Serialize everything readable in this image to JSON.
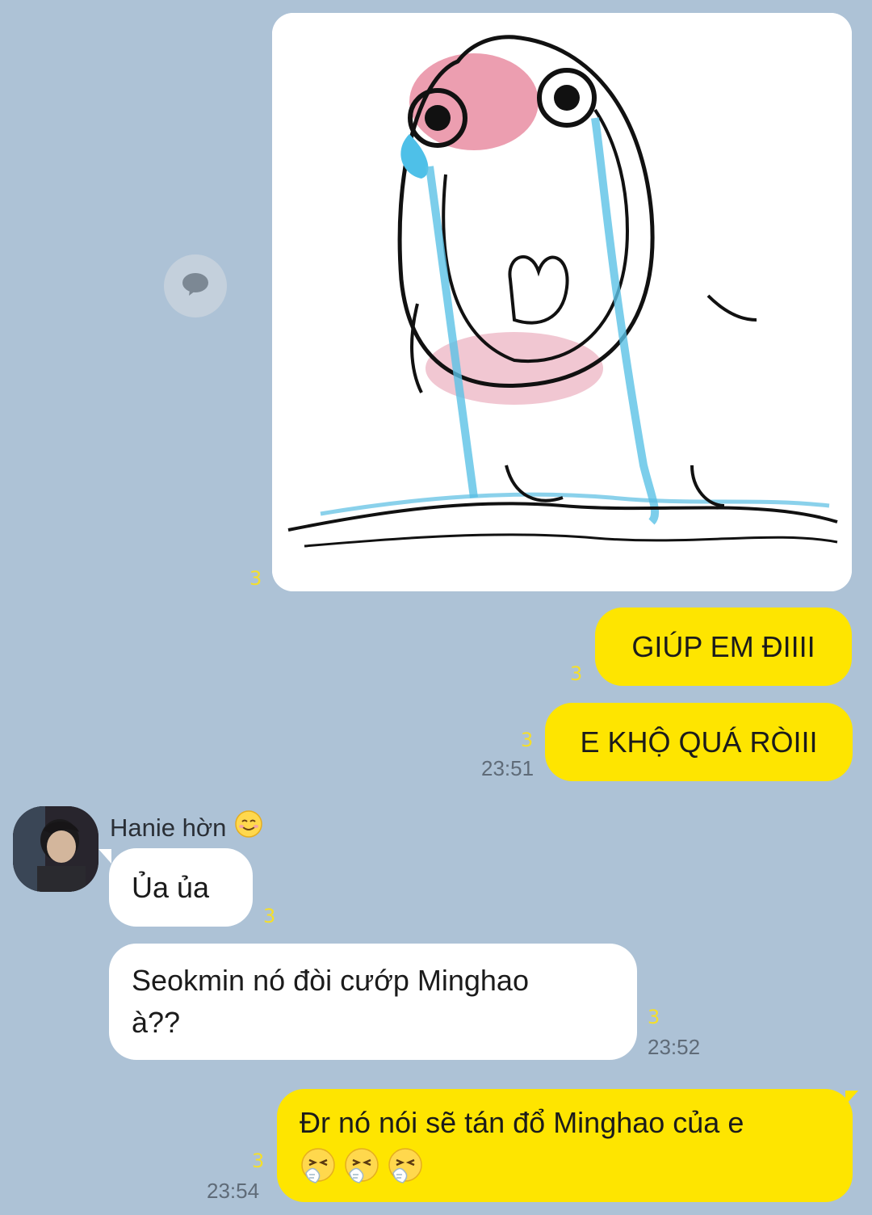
{
  "conversation": {
    "messages": [
      {
        "id": "img",
        "sender": "me",
        "kind": "image",
        "image_desc": "crying-doodle",
        "unread": "3"
      },
      {
        "id": "m1",
        "sender": "me",
        "text": "GIÚP EM ĐIIII",
        "unread": "3"
      },
      {
        "id": "m2",
        "sender": "me",
        "text": "E KHỘ QUÁ RÒIII",
        "unread": "3",
        "time": "23:51"
      },
      {
        "id": "m3",
        "sender": "them",
        "text": "Ủa ủa",
        "unread": "3"
      },
      {
        "id": "m4",
        "sender": "them",
        "line1": "Seokmin nó đòi cướp Minghao",
        "line2": "à??",
        "unread": "3",
        "time": "23:52"
      },
      {
        "id": "m5",
        "sender": "me",
        "text": "Đr nó nói sẽ tán đổ Minghao của e",
        "emoji_count": 3,
        "unread": "3",
        "time": "23:54"
      }
    ]
  },
  "contact": {
    "name": "Hanie hờn",
    "name_emoji": "smiling-face-emoji"
  },
  "icons": {
    "share": "speech-bubble-icon",
    "message_emoji": "sneezing-face-emoji"
  },
  "colors": {
    "background": "#adc2d6",
    "my_bubble": "#fee500",
    "their_bubble": "#ffffff",
    "unread": "#f5df2a",
    "time": "#5f6b78"
  }
}
